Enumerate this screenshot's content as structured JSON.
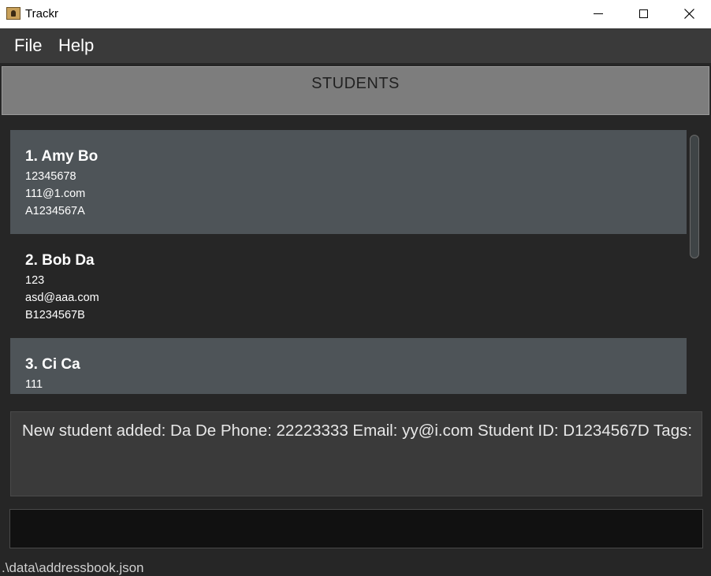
{
  "window": {
    "title": "Trackr"
  },
  "menu": {
    "file": "File",
    "help": "Help"
  },
  "list": {
    "header": "STUDENTS",
    "students": [
      {
        "index_name": "1.  Amy Bo",
        "phone": "12345678",
        "email": "111@1.com",
        "student_id": "A1234567A"
      },
      {
        "index_name": "2.  Bob Da",
        "phone": "123",
        "email": "asd@aaa.com",
        "student_id": "B1234567B"
      },
      {
        "index_name": "3.  Ci Ca",
        "phone": "111"
      }
    ]
  },
  "result": {
    "message": "New student added: Da De Phone: 22223333 Email: yy@i.com Student ID: D1234567D Tags:"
  },
  "command": {
    "value": "",
    "placeholder": ""
  },
  "status": {
    "path": ".\\data\\addressbook.json"
  },
  "colors": {
    "card_alt": "#4e5458",
    "background": "#262626",
    "menu": "#3a3a3a",
    "header": "#7d7d7d"
  }
}
